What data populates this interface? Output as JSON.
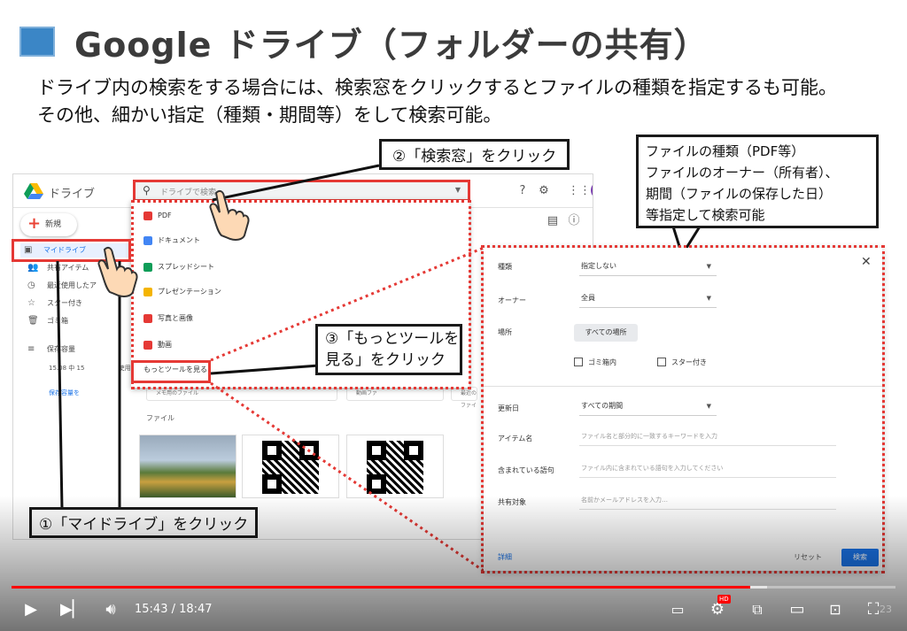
{
  "slide": {
    "title": "Google ドライブ（フォルダーの共有）",
    "desc_line1": "ドライブ内の検索をする場合には、検索窓をクリックするとファイルの種類を指定するも可能。",
    "desc_line2": "その他、細かい指定（種類・期間等）をして検索可能。",
    "page_number": "23"
  },
  "drive": {
    "app_name": "ドライブ",
    "search_placeholder": "ドライブで検索",
    "new_label": "新規",
    "nav": [
      {
        "label": "マイドライブ",
        "icon": "drive-folder-icon"
      },
      {
        "label": "共有アイテム",
        "icon": "people-icon"
      },
      {
        "label": "最近使用したア",
        "icon": "clock-icon"
      },
      {
        "label": "スター付き",
        "icon": "star-icon"
      },
      {
        "label": "ゴミ箱",
        "icon": "trash-icon"
      }
    ],
    "storage_label": "保存容量",
    "storage_usage": "15.08 中 15",
    "storage_usage_suffix": "使用",
    "storage_buy": "保存容量を",
    "files_label": "ファイル",
    "tile_1": "メモ用のファイル",
    "tile_2": "動画ファ",
    "tile_3": "最近のファイ",
    "dropdown": [
      {
        "label": "PDF",
        "color": "#e53935"
      },
      {
        "label": "ドキュメント",
        "color": "#4285f4"
      },
      {
        "label": "スプレッドシート",
        "color": "#0f9d58"
      },
      {
        "label": "プレゼンテーション",
        "color": "#f4b400"
      },
      {
        "label": "写真と画像",
        "color": "#e53935"
      },
      {
        "label": "動画",
        "color": "#e53935"
      }
    ],
    "more_tools": "もっとツールを見る"
  },
  "callouts": {
    "step1": "①「マイドライブ」をクリック",
    "step2": "②「検索窓」をクリック",
    "step3_line1": "③「もっとツールを",
    "step3_line2": "見る」をクリック",
    "info_line1": "ファイルの種類（PDF等）",
    "info_line2": "ファイルのオーナー（所有者）、",
    "info_line3": "期間（ファイルの保存した日）",
    "info_line4": "等指定して検索可能"
  },
  "advanced": {
    "type_label": "種類",
    "type_value": "指定しない",
    "owner_label": "オーナー",
    "owner_value": "全員",
    "location_label": "場所",
    "location_value": "すべての場所",
    "trash_label": "ゴミ箱内",
    "starred_label": "スター付き",
    "modified_label": "更新日",
    "modified_value": "すべての期間",
    "item_name_label": "アイテム名",
    "item_name_ph": "ファイル名と部分的に一致するキーワードを入力",
    "contains_label": "含まれている語句",
    "contains_ph": "ファイル内に含まれている語句を入力してください",
    "shared_label": "共有対象",
    "shared_ph": "名前かメールアドレスを入力…",
    "details_link": "詳細",
    "reset_btn": "リセット",
    "search_btn": "検索"
  },
  "player": {
    "time": "15:43 / 18:47",
    "progress": 0.836,
    "buffered": 0.855,
    "accent": "#ff0000",
    "hd_badge": "HD"
  }
}
